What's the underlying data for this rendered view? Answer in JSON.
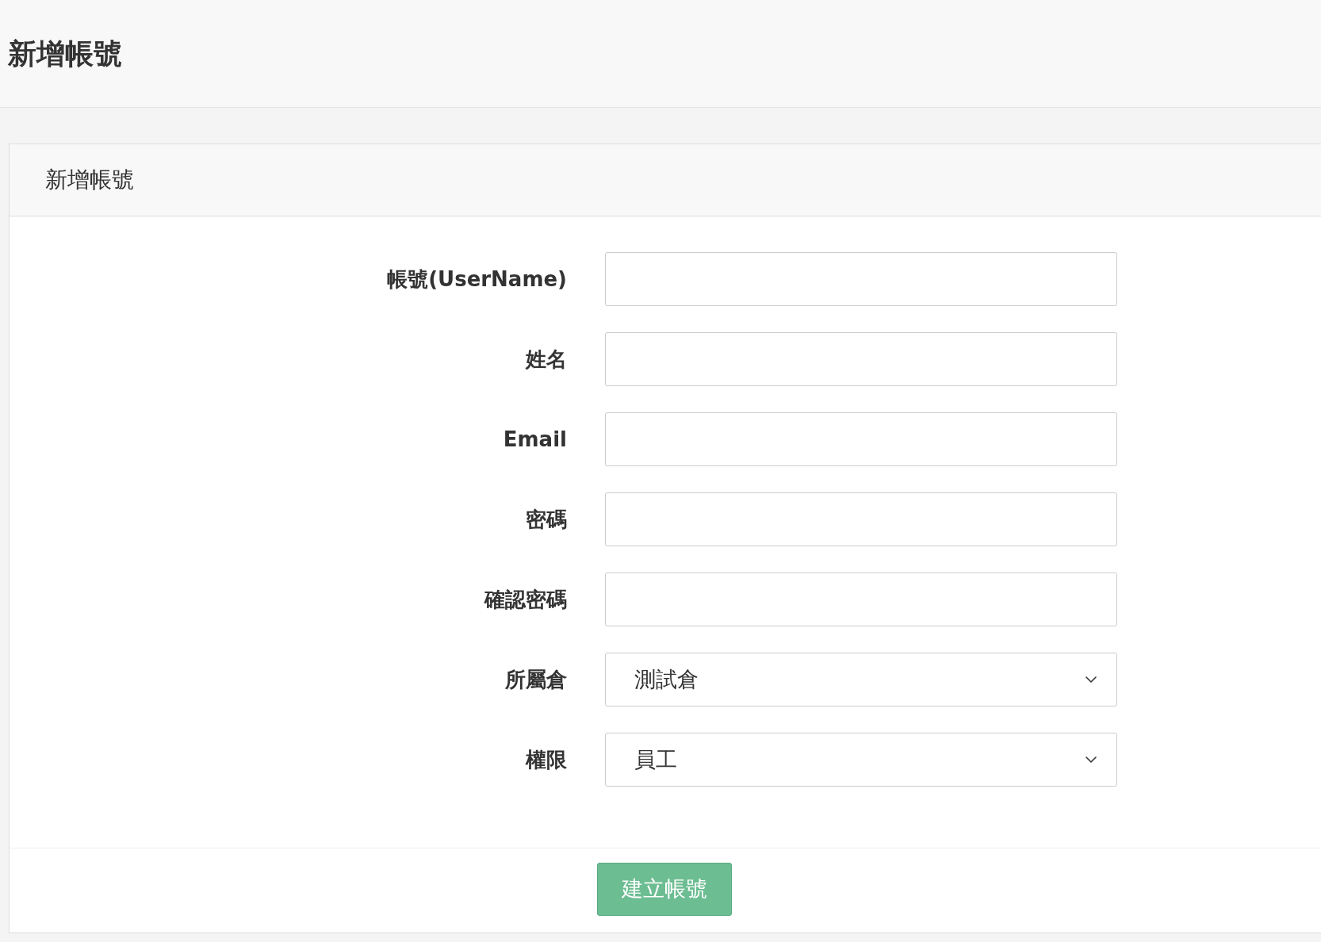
{
  "page_title": "新增帳號",
  "panel": {
    "title": "新增帳號",
    "fields": [
      {
        "label": "帳號(UserName)",
        "kind": "text"
      },
      {
        "label": "姓名",
        "kind": "text"
      },
      {
        "label": "Email",
        "kind": "text"
      },
      {
        "label": "密碼",
        "kind": "password"
      },
      {
        "label": "確認密碼",
        "kind": "password"
      },
      {
        "label": "所屬倉",
        "kind": "select",
        "value": "測試倉"
      },
      {
        "label": "權限",
        "kind": "select",
        "value": "員工"
      }
    ],
    "submit_button": "建立帳號"
  }
}
